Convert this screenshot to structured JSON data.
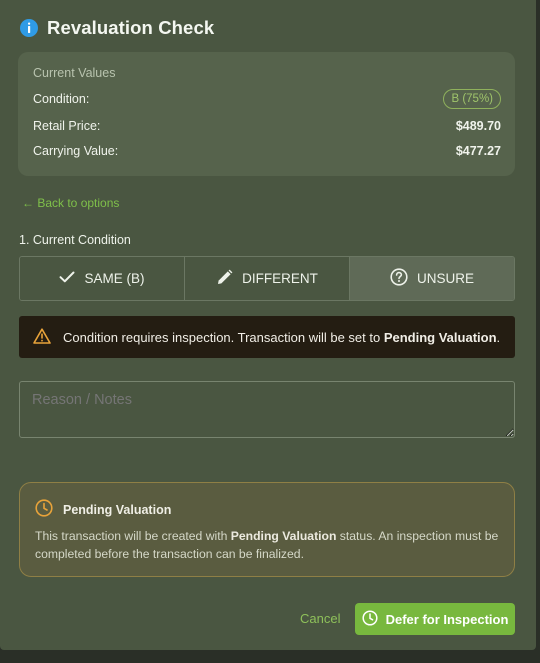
{
  "dialog": {
    "title": "Revaluation Check",
    "info_icon": "info-icon"
  },
  "current_values": {
    "caption": "Current Values",
    "condition_label": "Condition:",
    "condition_badge": "B (75%)",
    "retail_label": "Retail Price:",
    "retail_value": "$489.70",
    "carrying_label": "Carrying Value:",
    "carrying_value": "$477.27"
  },
  "back_link": "← Back to options",
  "section": {
    "title": "1. Current Condition",
    "options": [
      {
        "label": "SAME (B)",
        "icon": "check-icon",
        "selected": false
      },
      {
        "label": "DIFFERENT",
        "icon": "pencil-icon",
        "selected": false
      },
      {
        "label": "UNSURE",
        "icon": "question-circle-icon",
        "selected": true
      }
    ]
  },
  "warning": {
    "icon": "warning-triangle-icon",
    "text_prefix": "Condition requires inspection. Transaction will be set to ",
    "text_bold": "Pending Valuation",
    "text_suffix": "."
  },
  "notes": {
    "placeholder": "Reason / Notes",
    "value": ""
  },
  "pending": {
    "icon": "clock-icon",
    "title": "Pending Valuation",
    "body_prefix": "This transaction will be created with ",
    "body_bold": "Pending Valuation",
    "body_suffix": " status. An inspection must be completed before the transaction can be finalized."
  },
  "footer": {
    "cancel_label": "Cancel",
    "defer_label": "Defer for Inspection"
  },
  "colors": {
    "dialog_bg": "#4a5641",
    "accent_green": "#78b83e",
    "link_green": "#7fc04a",
    "warning_orange": "#e8a33a",
    "info_blue": "#2f9be6"
  }
}
